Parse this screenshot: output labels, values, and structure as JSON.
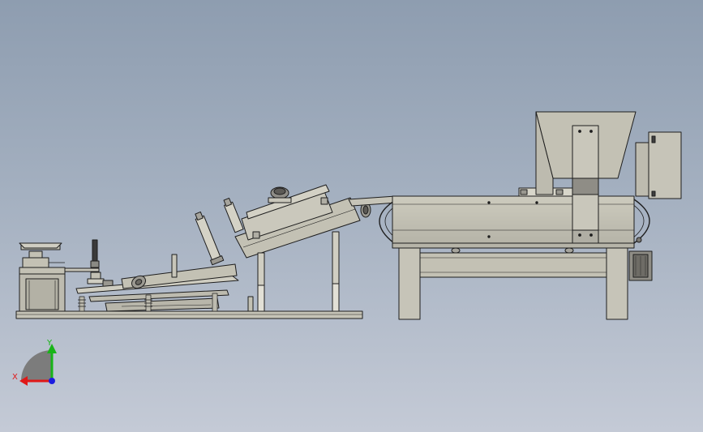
{
  "triad": {
    "x_label": "X",
    "y_label": "Y",
    "x_color": "#e01818",
    "y_color": "#18b418",
    "z_color": "#1c1ce0"
  },
  "colors": {
    "body": "#c3c1b4",
    "body_dark": "#b1afa2",
    "outline": "#1e1e1e",
    "shadow": "#8a8a82",
    "frame_dark": "#6e6e68"
  }
}
